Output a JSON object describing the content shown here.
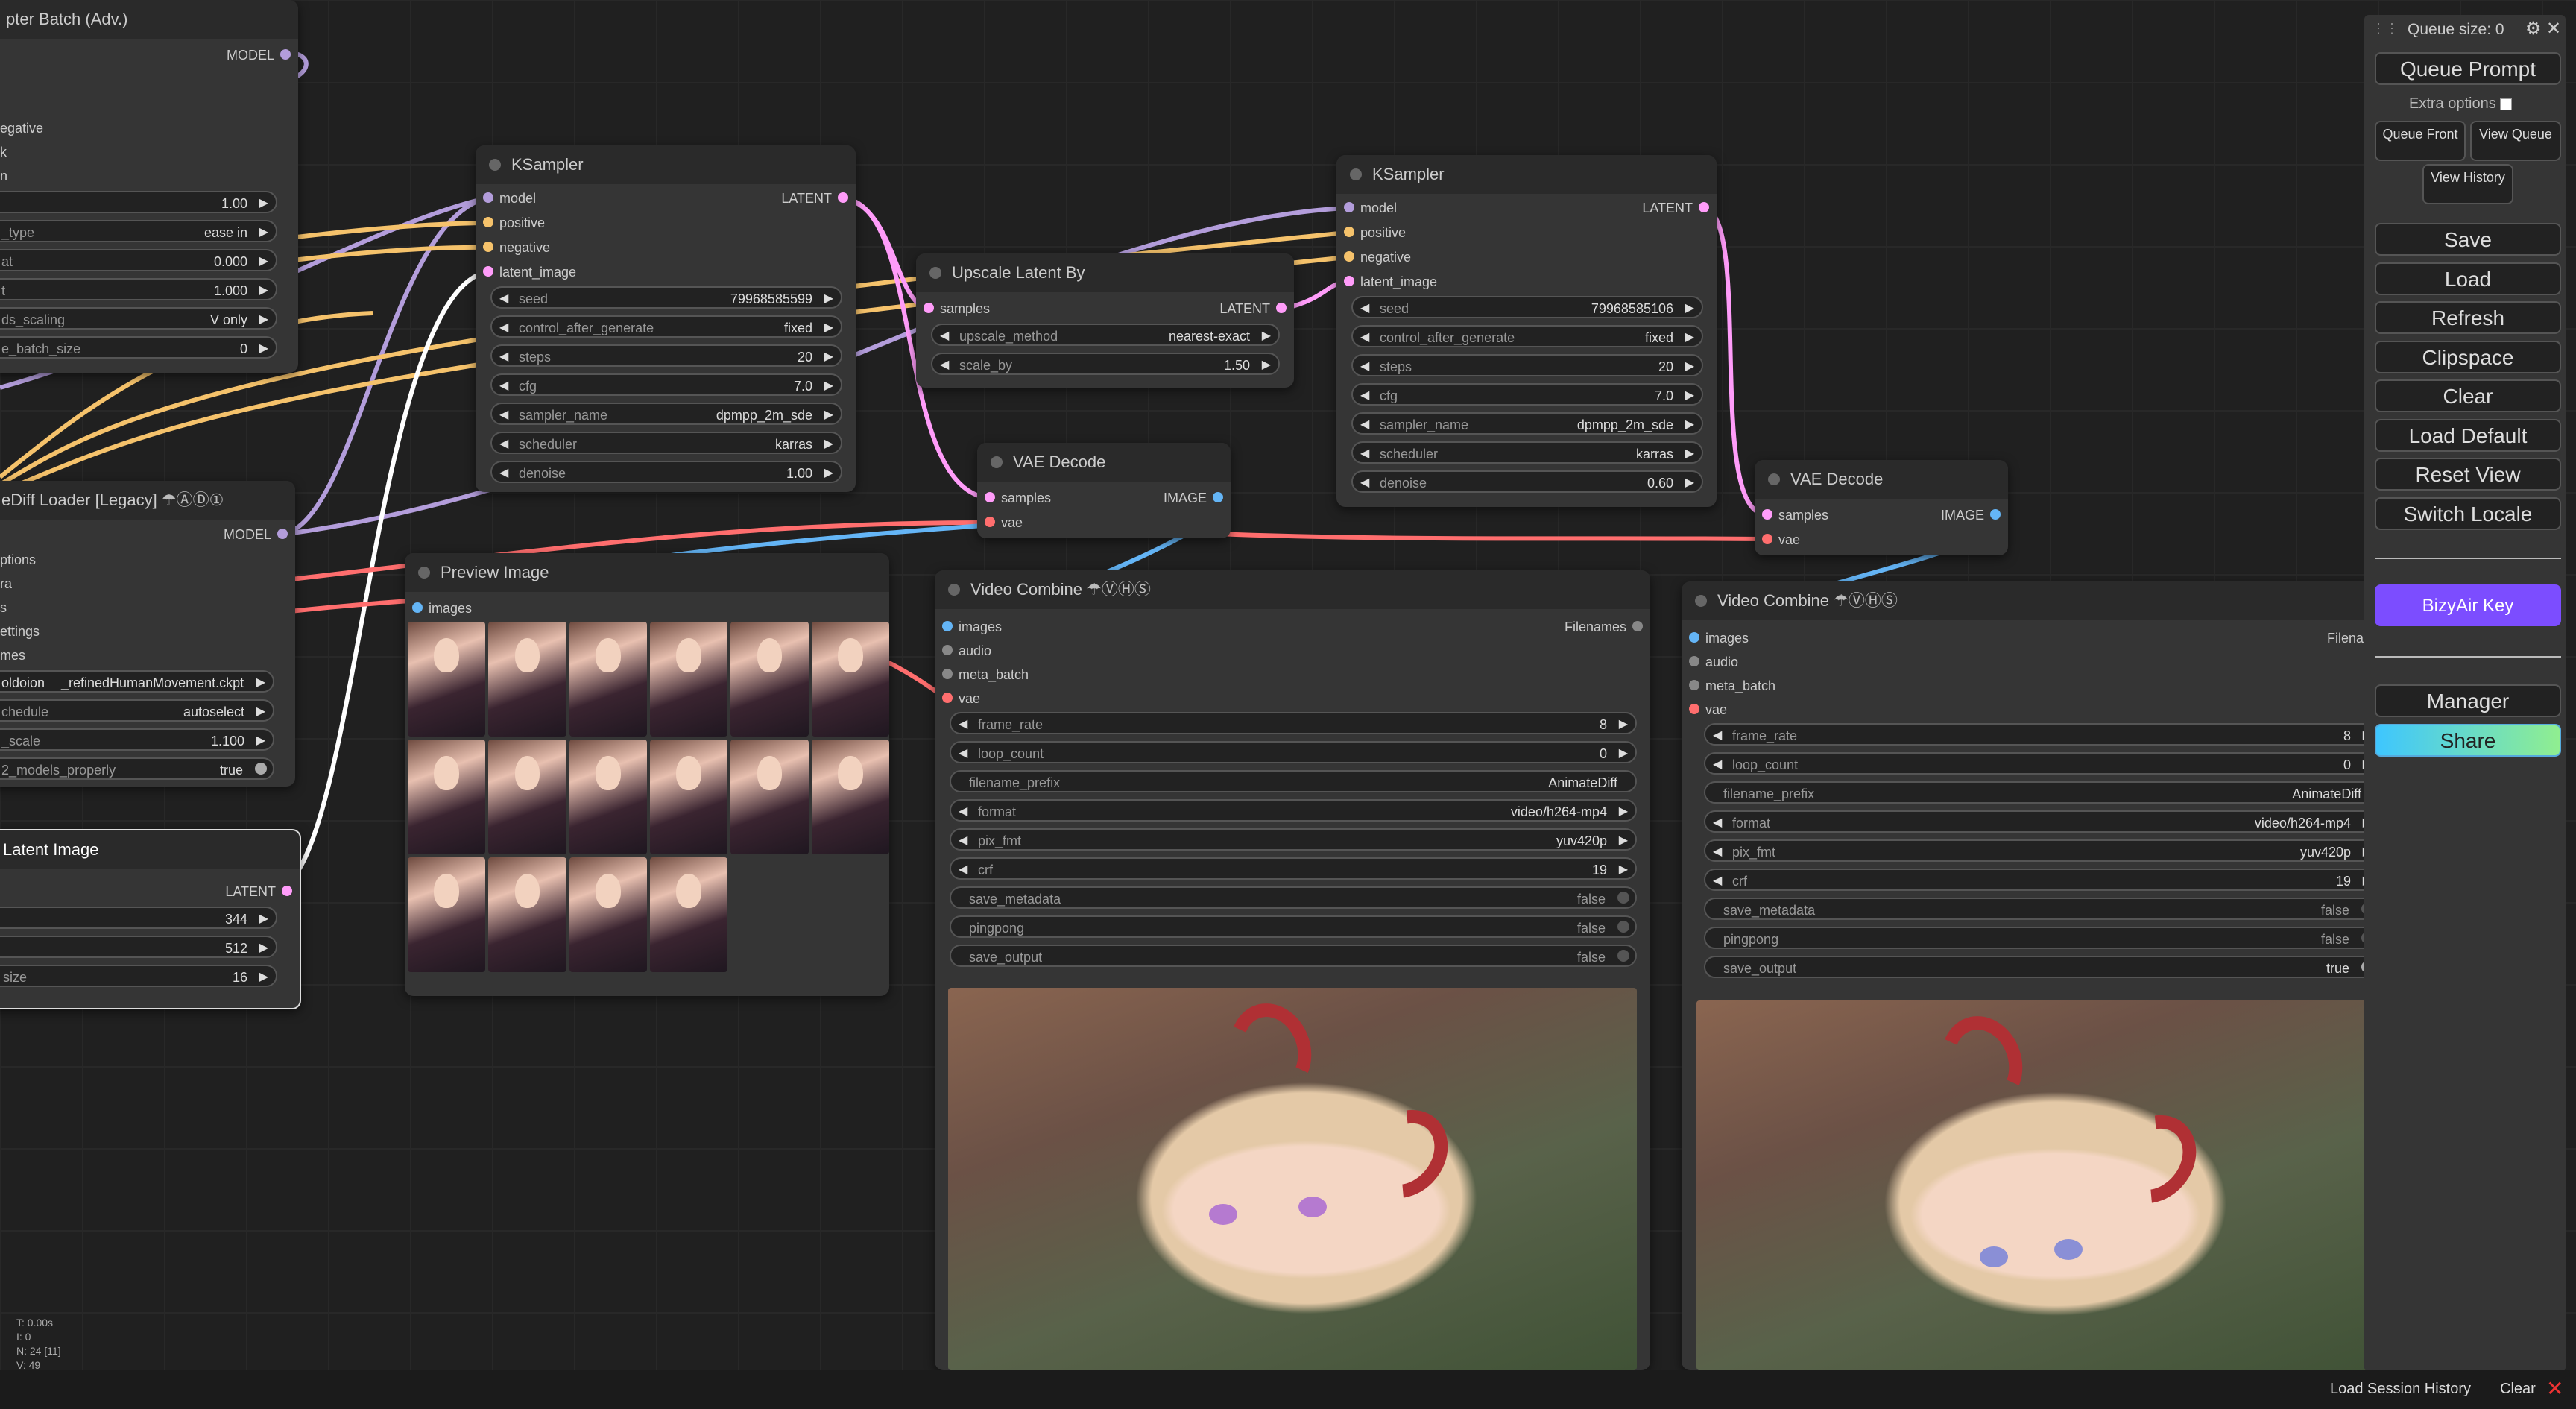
{
  "colors": {
    "background": "#202020",
    "node": "#353535",
    "model": "#b39ddb",
    "clip": "#f5c26b",
    "latent": "#ff9cf9",
    "image": "#64b5f6",
    "vae": "#ff6e6e",
    "bizyair": "#7c4dff",
    "share_gradient_start": "#3ec6ff",
    "share_gradient_end": "#90ee90"
  },
  "nodes": {
    "adapter_batch": {
      "title": "pter Batch (Adv.)",
      "output": "MODEL",
      "fragments": [
        "egative",
        "k",
        "n"
      ],
      "widgets": [
        {
          "label": "",
          "value": "1.00"
        },
        {
          "label": "_type",
          "value": "ease in"
        },
        {
          "label": "at",
          "value": "0.000"
        },
        {
          "label": "t",
          "value": "1.000"
        },
        {
          "label": "ds_scaling",
          "value": "V only"
        },
        {
          "label": "e_batch_size",
          "value": "0"
        }
      ]
    },
    "animatediff_loader": {
      "title": "eDiff Loader [Legacy]",
      "badges": "☂ⒶⒹ①",
      "output": "MODEL",
      "fragments": [
        "ptions",
        "ra",
        "s",
        "ettings",
        "mes"
      ],
      "widgets": [
        {
          "label": "oldoion",
          "value": "_refinedHumanMovement.ckpt"
        },
        {
          "label": "chedule",
          "value": "autoselect"
        },
        {
          "label": "_scale",
          "value": "1.100"
        },
        {
          "label": "2_models_properly",
          "value": "true"
        }
      ]
    },
    "empty_latent": {
      "title": "Latent Image",
      "output": "LATENT",
      "widgets": [
        {
          "label": "",
          "value": "344"
        },
        {
          "label": "",
          "value": "512"
        },
        {
          "label": "size",
          "value": "16"
        }
      ]
    },
    "ksampler1": {
      "title": "KSampler",
      "inputs": [
        "model",
        "positive",
        "negative",
        "latent_image"
      ],
      "output": "LATENT",
      "widgets": [
        {
          "label": "seed",
          "value": "79968585599"
        },
        {
          "label": "control_after_generate",
          "value": "fixed"
        },
        {
          "label": "steps",
          "value": "20"
        },
        {
          "label": "cfg",
          "value": "7.0"
        },
        {
          "label": "sampler_name",
          "value": "dpmpp_2m_sde"
        },
        {
          "label": "scheduler",
          "value": "karras"
        },
        {
          "label": "denoise",
          "value": "1.00"
        }
      ]
    },
    "upscale": {
      "title": "Upscale Latent By",
      "input": "samples",
      "output": "LATENT",
      "widgets": [
        {
          "label": "upscale_method",
          "value": "nearest-exact"
        },
        {
          "label": "scale_by",
          "value": "1.50"
        }
      ]
    },
    "vae_decode1": {
      "title": "VAE Decode",
      "inputs": [
        "samples",
        "vae"
      ],
      "output": "IMAGE"
    },
    "ksampler2": {
      "title": "KSampler",
      "inputs": [
        "model",
        "positive",
        "negative",
        "latent_image"
      ],
      "output": "LATENT",
      "widgets": [
        {
          "label": "seed",
          "value": "79968585106"
        },
        {
          "label": "control_after_generate",
          "value": "fixed"
        },
        {
          "label": "steps",
          "value": "20"
        },
        {
          "label": "cfg",
          "value": "7.0"
        },
        {
          "label": "sampler_name",
          "value": "dpmpp_2m_sde"
        },
        {
          "label": "scheduler",
          "value": "karras"
        },
        {
          "label": "denoise",
          "value": "0.60"
        }
      ]
    },
    "vae_decode2": {
      "title": "VAE Decode",
      "inputs": [
        "samples",
        "vae"
      ],
      "output": "IMAGE"
    },
    "preview": {
      "title": "Preview Image",
      "input": "images"
    },
    "video1": {
      "title": "Video Combine",
      "badge": "☂ⓋⒽⓈ",
      "inputs": [
        "images",
        "audio",
        "meta_batch",
        "vae"
      ],
      "output": "Filenames",
      "widgets": [
        {
          "label": "frame_rate",
          "value": "8"
        },
        {
          "label": "loop_count",
          "value": "0"
        },
        {
          "label": "filename_prefix",
          "value": "AnimateDiff"
        },
        {
          "label": "format",
          "value": "video/h264-mp4"
        },
        {
          "label": "pix_fmt",
          "value": "yuv420p"
        },
        {
          "label": "crf",
          "value": "19"
        }
      ],
      "toggles": [
        {
          "label": "save_metadata",
          "value": "false"
        },
        {
          "label": "pingpong",
          "value": "false"
        },
        {
          "label": "save_output",
          "value": "false"
        }
      ]
    },
    "video2": {
      "title": "Video Combine",
      "badge": "☂ⓋⒽⓈ",
      "inputs": [
        "images",
        "audio",
        "meta_batch",
        "vae"
      ],
      "output": "Filename",
      "widgets": [
        {
          "label": "frame_rate",
          "value": "8"
        },
        {
          "label": "loop_count",
          "value": "0"
        },
        {
          "label": "filename_prefix",
          "value": "AnimateDiff"
        },
        {
          "label": "format",
          "value": "video/h264-mp4"
        },
        {
          "label": "pix_fmt",
          "value": "yuv420p"
        },
        {
          "label": "crf",
          "value": "19"
        }
      ],
      "toggles": [
        {
          "label": "save_metadata",
          "value": "false"
        },
        {
          "label": "pingpong",
          "value": "false"
        },
        {
          "label": "save_output",
          "value": "true"
        }
      ]
    }
  },
  "menu": {
    "queue_size": "Queue size: 0",
    "queue_prompt": "Queue Prompt",
    "extra_options": "Extra options",
    "queue_front": "Queue Front",
    "view_queue": "View Queue",
    "view_history": "View History",
    "buttons": [
      "Save",
      "Load",
      "Refresh",
      "Clipspace",
      "Clear",
      "Load Default",
      "Reset View",
      "Switch Locale"
    ],
    "bizyair": "BizyAir Key",
    "manager": "Manager",
    "share": "Share"
  },
  "stats": {
    "t": "T: 0.00s",
    "i": "I: 0",
    "n": "N: 24 [11]",
    "v": "V: 49"
  },
  "bottom": {
    "load_session": "Load Session History",
    "clear": "Clear"
  }
}
